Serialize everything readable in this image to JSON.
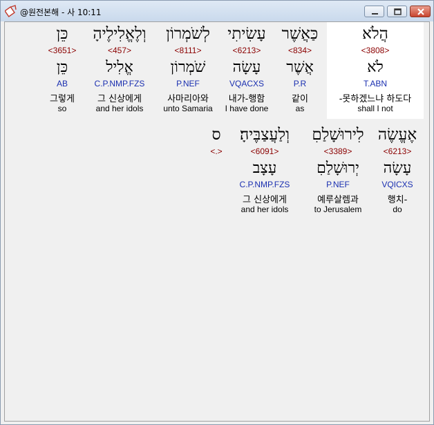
{
  "window": {
    "title": "@원전본해 - 사 10:11",
    "minimize_label": "minimize",
    "maximize_label": "maximize",
    "close_label": "close"
  },
  "row1": [
    {
      "hebrew": "כֵּן",
      "strong": "<3651>",
      "lemma": "כֵּן",
      "morph": "AB",
      "korean": "그렇게",
      "english": "so"
    },
    {
      "hebrew": "וְלֶאֱלִילֶיהָ",
      "strong": "<457>",
      "lemma": "אֱלִיל",
      "morph": "C.P.NMP.FZS",
      "korean": "그 신상에게",
      "english": "and her idols"
    },
    {
      "hebrew": "לְשֹׁמְרוֹן",
      "strong": "<8111>",
      "lemma": "שֹׁמְרוֹן",
      "morph": "P.NEF",
      "korean": "사마리아와",
      "english": "unto Samaria"
    },
    {
      "hebrew": "עָשִׂיתִי",
      "strong": "<6213>",
      "lemma": "עָשָׂה",
      "morph": "VQACXS",
      "korean": "내가-행함",
      "english": "I have done"
    },
    {
      "hebrew": "כַּאֲשֶׁר",
      "strong": "<834>",
      "lemma": "אֲשֶׁר",
      "morph": "P.R",
      "korean": "같이",
      "english": "as"
    },
    {
      "hebrew": "הֲלֹא",
      "strong": "<3808>",
      "lemma": "לֹא",
      "morph": "T.ABN",
      "korean": "-못하겠느냐 하도다",
      "english": "shall I not"
    }
  ],
  "row2": [
    {
      "hebrew": "ס",
      "strong": "<.>",
      "lemma": "",
      "morph": "",
      "korean": "",
      "english": ""
    },
    {
      "hebrew": "וְלַעֲצַבֶּיהָ׃",
      "strong": "<6091>",
      "lemma": "עָצָב",
      "morph": "C.P.NMP.FZS",
      "korean": "그 신상에게",
      "english": "and her idols"
    },
    {
      "hebrew": "לִירוּשָׁלַםִ",
      "strong": "<3389>",
      "lemma": "יְרוּשָׁלַםִ",
      "morph": "P.NEF",
      "korean": "예루살렘과",
      "english": "to Jerusalem"
    },
    {
      "hebrew": "אֶעֱשֶׂה",
      "strong": "<6213>",
      "lemma": "עָשָׂה",
      "morph": "VQICXS",
      "korean": "행치-",
      "english": "do"
    }
  ],
  "colors": {
    "strong": "#8b0000",
    "morph": "#1a2fb0",
    "highlight": "#ffffff",
    "close_button": "#c9452f"
  }
}
